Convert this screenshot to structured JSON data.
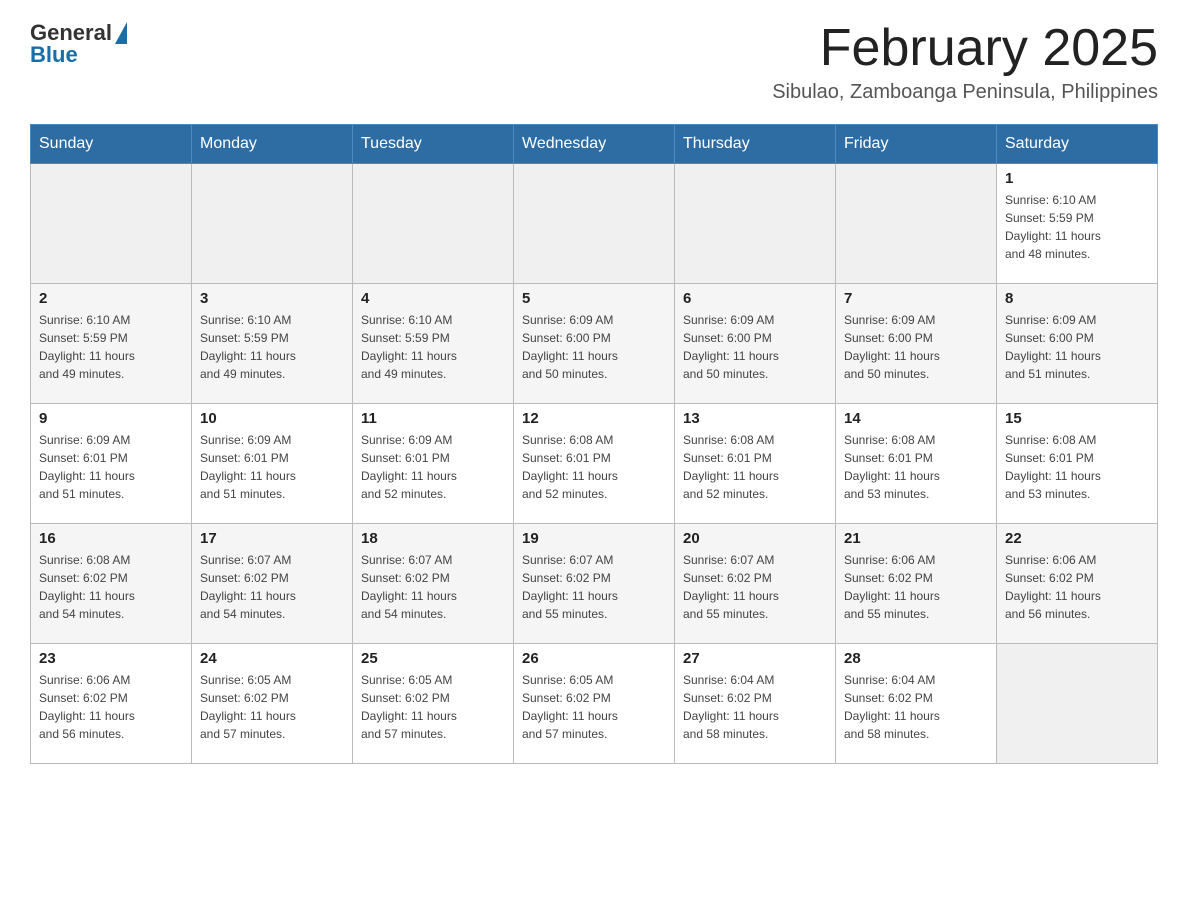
{
  "header": {
    "logo_general": "General",
    "logo_blue": "Blue",
    "month_title": "February 2025",
    "subtitle": "Sibulao, Zamboanga Peninsula, Philippines"
  },
  "weekdays": [
    "Sunday",
    "Monday",
    "Tuesday",
    "Wednesday",
    "Thursday",
    "Friday",
    "Saturday"
  ],
  "weeks": [
    [
      {
        "day": "",
        "info": ""
      },
      {
        "day": "",
        "info": ""
      },
      {
        "day": "",
        "info": ""
      },
      {
        "day": "",
        "info": ""
      },
      {
        "day": "",
        "info": ""
      },
      {
        "day": "",
        "info": ""
      },
      {
        "day": "1",
        "info": "Sunrise: 6:10 AM\nSunset: 5:59 PM\nDaylight: 11 hours\nand 48 minutes."
      }
    ],
    [
      {
        "day": "2",
        "info": "Sunrise: 6:10 AM\nSunset: 5:59 PM\nDaylight: 11 hours\nand 49 minutes."
      },
      {
        "day": "3",
        "info": "Sunrise: 6:10 AM\nSunset: 5:59 PM\nDaylight: 11 hours\nand 49 minutes."
      },
      {
        "day": "4",
        "info": "Sunrise: 6:10 AM\nSunset: 5:59 PM\nDaylight: 11 hours\nand 49 minutes."
      },
      {
        "day": "5",
        "info": "Sunrise: 6:09 AM\nSunset: 6:00 PM\nDaylight: 11 hours\nand 50 minutes."
      },
      {
        "day": "6",
        "info": "Sunrise: 6:09 AM\nSunset: 6:00 PM\nDaylight: 11 hours\nand 50 minutes."
      },
      {
        "day": "7",
        "info": "Sunrise: 6:09 AM\nSunset: 6:00 PM\nDaylight: 11 hours\nand 50 minutes."
      },
      {
        "day": "8",
        "info": "Sunrise: 6:09 AM\nSunset: 6:00 PM\nDaylight: 11 hours\nand 51 minutes."
      }
    ],
    [
      {
        "day": "9",
        "info": "Sunrise: 6:09 AM\nSunset: 6:01 PM\nDaylight: 11 hours\nand 51 minutes."
      },
      {
        "day": "10",
        "info": "Sunrise: 6:09 AM\nSunset: 6:01 PM\nDaylight: 11 hours\nand 51 minutes."
      },
      {
        "day": "11",
        "info": "Sunrise: 6:09 AM\nSunset: 6:01 PM\nDaylight: 11 hours\nand 52 minutes."
      },
      {
        "day": "12",
        "info": "Sunrise: 6:08 AM\nSunset: 6:01 PM\nDaylight: 11 hours\nand 52 minutes."
      },
      {
        "day": "13",
        "info": "Sunrise: 6:08 AM\nSunset: 6:01 PM\nDaylight: 11 hours\nand 52 minutes."
      },
      {
        "day": "14",
        "info": "Sunrise: 6:08 AM\nSunset: 6:01 PM\nDaylight: 11 hours\nand 53 minutes."
      },
      {
        "day": "15",
        "info": "Sunrise: 6:08 AM\nSunset: 6:01 PM\nDaylight: 11 hours\nand 53 minutes."
      }
    ],
    [
      {
        "day": "16",
        "info": "Sunrise: 6:08 AM\nSunset: 6:02 PM\nDaylight: 11 hours\nand 54 minutes."
      },
      {
        "day": "17",
        "info": "Sunrise: 6:07 AM\nSunset: 6:02 PM\nDaylight: 11 hours\nand 54 minutes."
      },
      {
        "day": "18",
        "info": "Sunrise: 6:07 AM\nSunset: 6:02 PM\nDaylight: 11 hours\nand 54 minutes."
      },
      {
        "day": "19",
        "info": "Sunrise: 6:07 AM\nSunset: 6:02 PM\nDaylight: 11 hours\nand 55 minutes."
      },
      {
        "day": "20",
        "info": "Sunrise: 6:07 AM\nSunset: 6:02 PM\nDaylight: 11 hours\nand 55 minutes."
      },
      {
        "day": "21",
        "info": "Sunrise: 6:06 AM\nSunset: 6:02 PM\nDaylight: 11 hours\nand 55 minutes."
      },
      {
        "day": "22",
        "info": "Sunrise: 6:06 AM\nSunset: 6:02 PM\nDaylight: 11 hours\nand 56 minutes."
      }
    ],
    [
      {
        "day": "23",
        "info": "Sunrise: 6:06 AM\nSunset: 6:02 PM\nDaylight: 11 hours\nand 56 minutes."
      },
      {
        "day": "24",
        "info": "Sunrise: 6:05 AM\nSunset: 6:02 PM\nDaylight: 11 hours\nand 57 minutes."
      },
      {
        "day": "25",
        "info": "Sunrise: 6:05 AM\nSunset: 6:02 PM\nDaylight: 11 hours\nand 57 minutes."
      },
      {
        "day": "26",
        "info": "Sunrise: 6:05 AM\nSunset: 6:02 PM\nDaylight: 11 hours\nand 57 minutes."
      },
      {
        "day": "27",
        "info": "Sunrise: 6:04 AM\nSunset: 6:02 PM\nDaylight: 11 hours\nand 58 minutes."
      },
      {
        "day": "28",
        "info": "Sunrise: 6:04 AM\nSunset: 6:02 PM\nDaylight: 11 hours\nand 58 minutes."
      },
      {
        "day": "",
        "info": ""
      }
    ]
  ]
}
